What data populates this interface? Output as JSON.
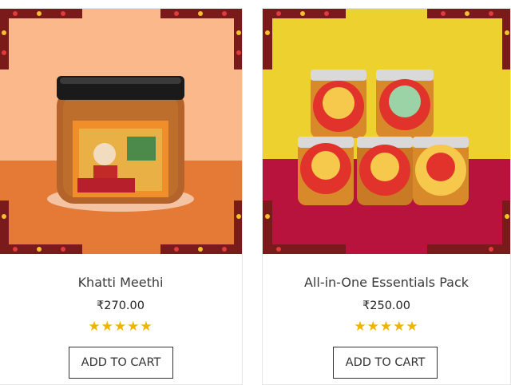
{
  "products": [
    {
      "name": "Khatti Meethi",
      "price": "₹270.00",
      "rating": 5,
      "rating_max": 5,
      "cart_label": "ADD TO CART",
      "bg_top": "#fbb88a",
      "bg_bottom": "#e47a35"
    },
    {
      "name": "All-in-One Essentials Pack",
      "price": "₹250.00",
      "rating": 5,
      "rating_max": 5,
      "cart_label": "ADD TO CART",
      "bg_top": "#ecd12f",
      "bg_bottom": "#b8133d"
    }
  ],
  "colors": {
    "star": "#f0b400",
    "text": "#3a3a3a"
  }
}
